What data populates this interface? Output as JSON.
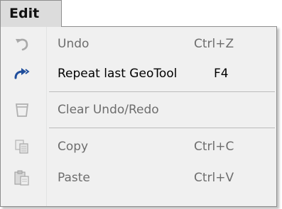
{
  "menubar": {
    "tab_label": "Edit"
  },
  "menu": {
    "items": [
      {
        "label": "Undo",
        "shortcut": "Ctrl+Z",
        "icon": "undo-icon",
        "enabled": false
      },
      {
        "label": "Repeat last GeoTool",
        "shortcut": "F4",
        "icon": "repeat-icon",
        "enabled": true
      },
      {
        "label": "Clear Undo/Redo",
        "shortcut": "",
        "icon": "clear-history-icon",
        "enabled": false
      },
      {
        "label": "Copy",
        "shortcut": "Ctrl+C",
        "icon": "copy-icon",
        "enabled": false
      },
      {
        "label": "Paste",
        "shortcut": "Ctrl+V",
        "icon": "paste-icon",
        "enabled": false
      }
    ]
  },
  "colors": {
    "repeat_icon": "#1f4e9c",
    "disabled_text": "#6d6d6d",
    "panel_bg": "#f0f0f0"
  }
}
